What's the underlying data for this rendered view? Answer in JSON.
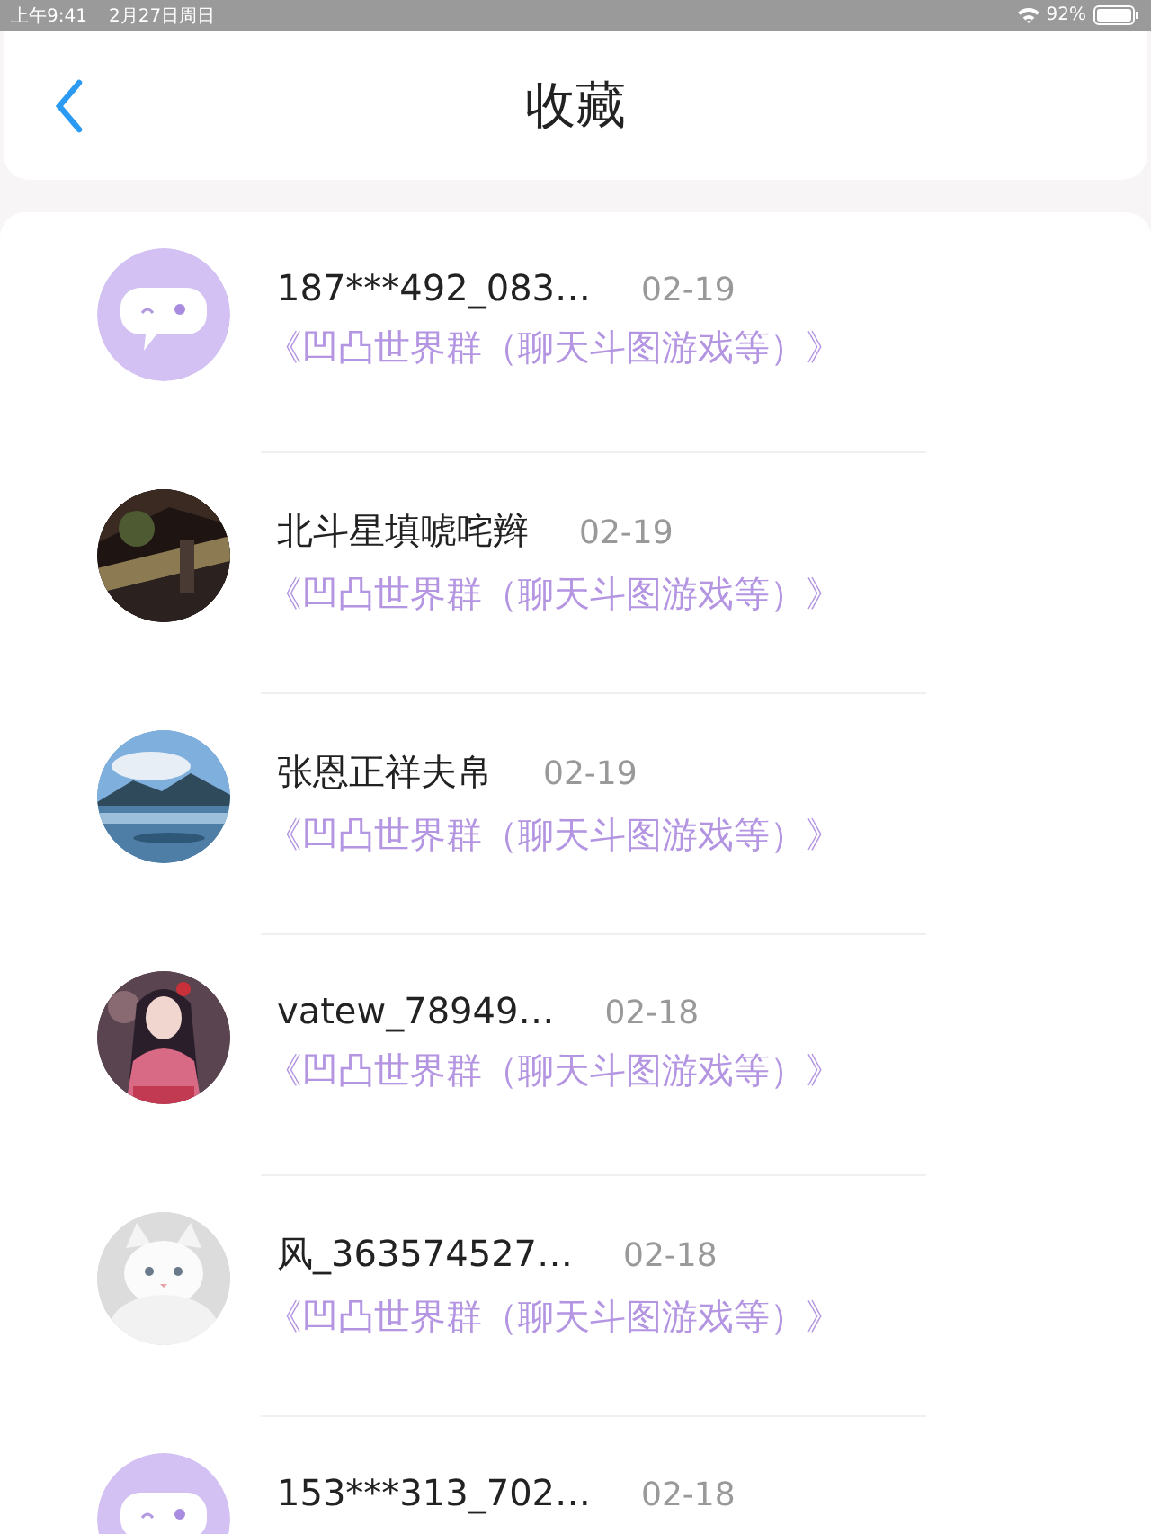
{
  "status_bar": {
    "time": "上午9:41",
    "date": "2月27日周日",
    "battery": "92%"
  },
  "header": {
    "title": "收藏"
  },
  "items": [
    {
      "avatar": {
        "kind": "default"
      },
      "name": "187***492_083…",
      "date": "02-19",
      "subtitle": "《凹凸世界群（聊天斗图游戏等）》"
    },
    {
      "name": "北斗星填唬咤辫",
      "date": "02-19",
      "subtitle": "《凹凸世界群（聊天斗图游戏等）》"
    },
    {
      "name": "张恩正祥夫帛",
      "date": "02-19",
      "subtitle": "《凹凸世界群（聊天斗图游戏等）》"
    },
    {
      "name": "vatew_78949…",
      "date": "02-18",
      "subtitle": "《凹凸世界群（聊天斗图游戏等）》"
    },
    {
      "name": "风_363574527…",
      "date": "02-18",
      "subtitle": "《凹凸世界群（聊天斗图游戏等）》"
    },
    {
      "avatar": {
        "kind": "default"
      },
      "name": "153***313_702…",
      "date": "02-18"
    }
  ]
}
